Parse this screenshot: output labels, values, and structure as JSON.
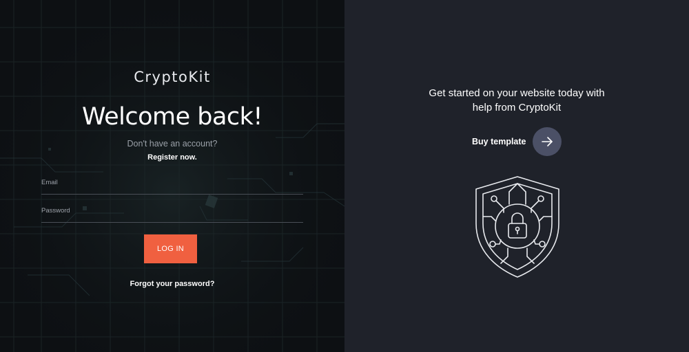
{
  "login": {
    "brand": "CryptoKit",
    "heading": "Welcome back!",
    "no_account_text": "Don't have an account?",
    "register_link": "Register now.",
    "email_label": "Email",
    "password_label": "Password",
    "login_button": "LOG IN",
    "forgot_link": "Forgot your password?"
  },
  "promo": {
    "tagline_line1": "Get started on your website today with",
    "tagline_line2": "help from CryptoKit",
    "buy_label": "Buy template",
    "buy_icon": "arrow-right-icon",
    "illustration_icon": "shield-lock-icon"
  },
  "colors": {
    "left_bg": "#0d1013",
    "right_bg": "#1f222a",
    "accent": "#f06040",
    "buy_circle": "#4b5066"
  }
}
